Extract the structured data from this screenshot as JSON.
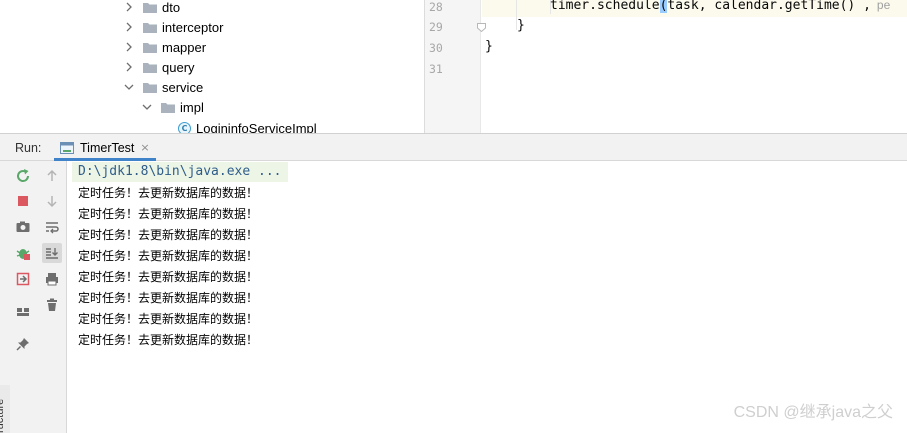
{
  "project_tree": {
    "items": [
      {
        "label": "dto",
        "kind": "folder",
        "expanded": false
      },
      {
        "label": "interceptor",
        "kind": "folder",
        "expanded": false
      },
      {
        "label": "mapper",
        "kind": "folder",
        "expanded": false
      },
      {
        "label": "query",
        "kind": "folder",
        "expanded": false
      },
      {
        "label": "service",
        "kind": "folder",
        "expanded": true
      },
      {
        "label": "impl",
        "kind": "folder",
        "expanded": true
      },
      {
        "label": "LogininfoServiceImpl",
        "kind": "class",
        "badge": "C"
      }
    ]
  },
  "editor": {
    "lines": [
      {
        "number": "28",
        "pre": "timer.schedule",
        "paren": "(",
        "post": "task, calendar.getTime() ,",
        "hint": "pe"
      },
      {
        "number": "29",
        "text": "}"
      },
      {
        "number": "30",
        "text": "}"
      },
      {
        "number": "31",
        "text": ""
      }
    ]
  },
  "run": {
    "label": "Run:",
    "tab_title": "TimerTest",
    "tab_close": "×",
    "command": "D:\\jdk1.8\\bin\\java.exe ...",
    "output": [
      "定时任务！去更新数据库的数据！",
      "定时任务！去更新数据库的数据！",
      "定时任务！去更新数据库的数据！",
      "定时任务！去更新数据库的数据！",
      "定时任务！去更新数据库的数据！",
      "定时任务！去更新数据库的数据！",
      "定时任务！去更新数据库的数据！",
      "定时任务！去更新数据库的数据！"
    ]
  },
  "side_panel_label": "ructure",
  "watermark": "CSDN @继承java之父",
  "colors": {
    "rerun": "#59a869",
    "stop": "#db5860",
    "accent": "#4083c9",
    "command_bg": "#edf5e6",
    "command_text": "#2f5d8a"
  },
  "icons": [
    "rerun-icon",
    "stop-icon",
    "camera-icon",
    "debug-icon",
    "exit-icon",
    "layout-icon",
    "pin-icon",
    "up-arrow-icon",
    "down-arrow-icon",
    "soft-wrap-icon",
    "scroll-to-end-icon",
    "print-icon",
    "trash-icon"
  ]
}
